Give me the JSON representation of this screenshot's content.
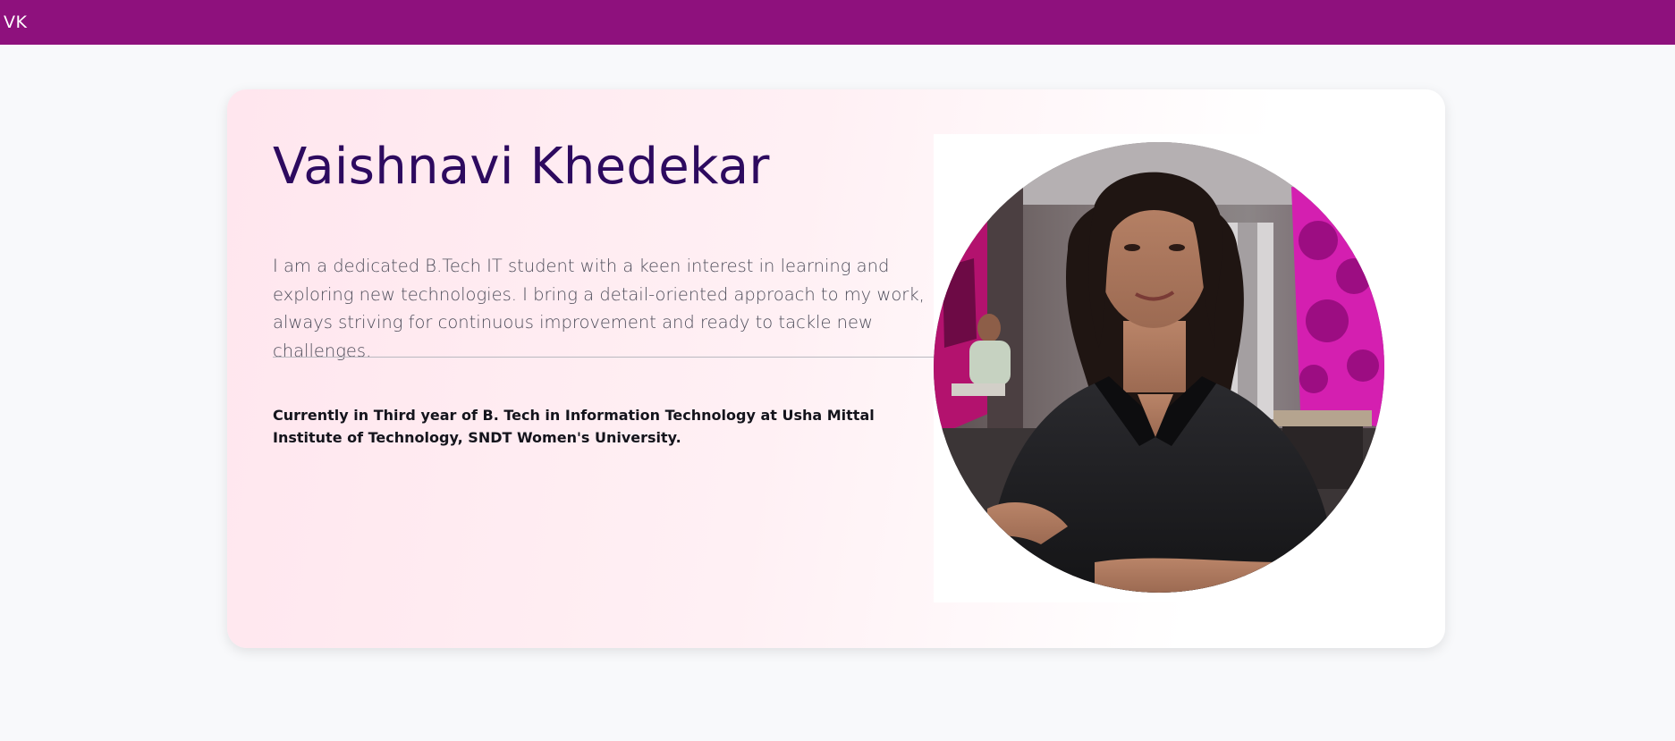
{
  "navbar": {
    "brand": "VK",
    "background_color": "#8e117d"
  },
  "profile": {
    "name": "Vaishnavi Khedekar",
    "bio": "I am a dedicated B.Tech IT student with a keen interest in learning and exploring new technologies. I bring a detail-oriented approach to my work, always striving for continuous improvement and ready to tackle new challenges.",
    "education": "Currently in Third year of B. Tech in Information Technology at Usha Mittal Institute of Technology, SNDT Women's University.",
    "photo": {
      "subject": "profile-photo",
      "shape": "circle"
    }
  },
  "colors": {
    "page_background": "#f8f9fb",
    "name_color": "#2d0a5f",
    "card_gradient_start": "#ffe6ee",
    "card_gradient_end": "#ffffff"
  }
}
